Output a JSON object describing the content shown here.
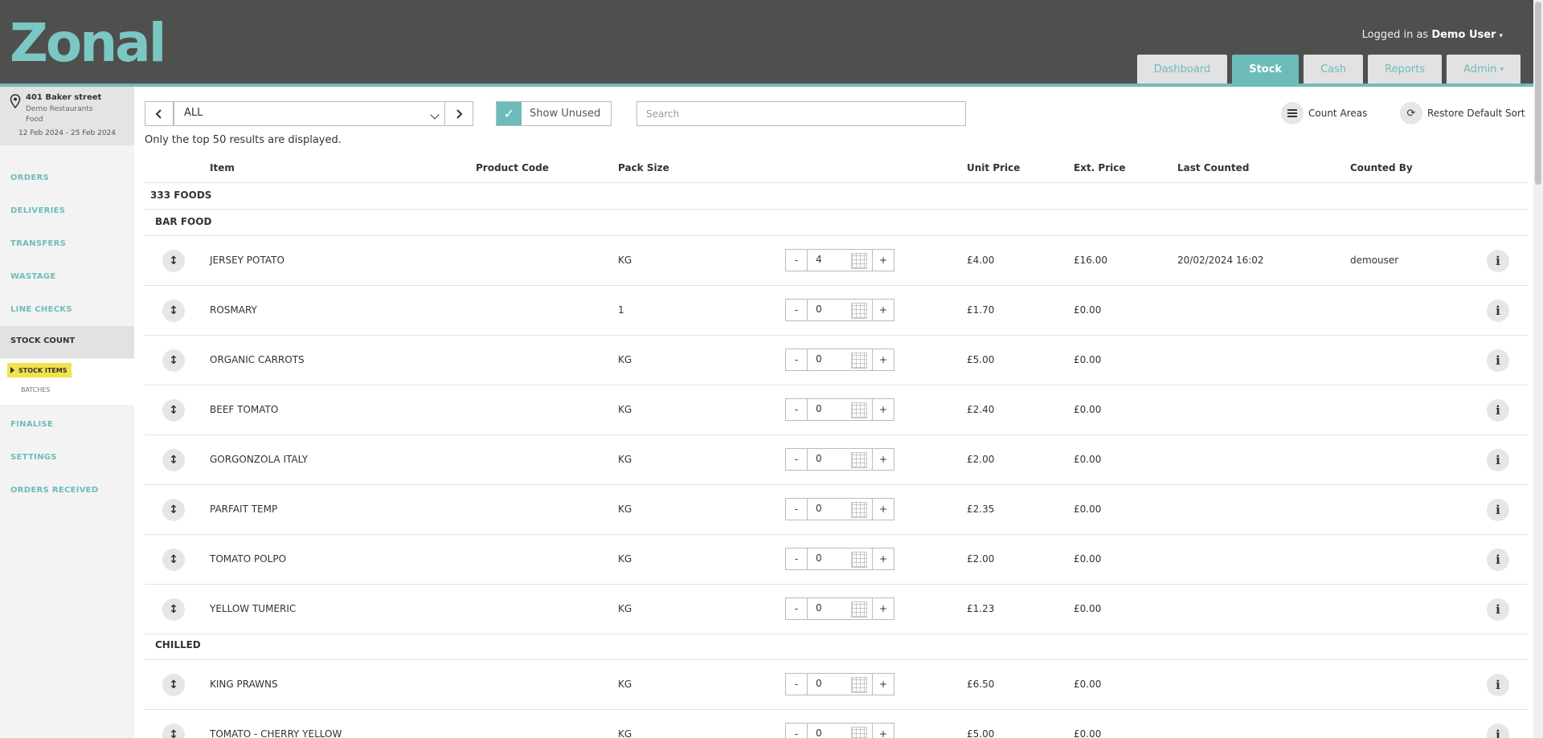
{
  "header": {
    "logo_text": "Zonal",
    "login_prefix": "Logged in as",
    "login_user": "Demo User",
    "nav": [
      {
        "label": "Dashboard",
        "active": false
      },
      {
        "label": "Stock",
        "active": true
      },
      {
        "label": "Cash",
        "active": false
      },
      {
        "label": "Reports",
        "active": false
      },
      {
        "label": "Admin",
        "active": false
      }
    ]
  },
  "location": {
    "name": "401 Baker street",
    "line1": "Demo Restaurants",
    "line2": "Food",
    "dates": "12 Feb 2024 - 25 Feb 2024"
  },
  "sidebar": {
    "items": [
      "ORDERS",
      "DELIVERIES",
      "TRANSFERS",
      "WASTAGE",
      "LINE CHECKS"
    ],
    "active": "STOCK COUNT",
    "sub_items": [
      "STOCK ITEMS",
      "BATCHES"
    ],
    "items_after": [
      "FINALISE",
      "SETTINGS",
      "ORDERS RECEIVED"
    ]
  },
  "toolbar": {
    "filter_value": "ALL",
    "show_unused": "Show Unused",
    "search_placeholder": "Search",
    "count_areas": "Count Areas",
    "restore_sort": "Restore Default Sort"
  },
  "notice": "Only the top 50 results are displayed.",
  "table": {
    "headers": {
      "item": "Item",
      "product_code": "Product Code",
      "pack_size": "Pack Size",
      "unit_price": "Unit Price",
      "ext_price": "Ext. Price",
      "last_counted": "Last Counted",
      "counted_by": "Counted By"
    },
    "category": "333 FOODS",
    "groups": [
      {
        "name": "BAR FOOD",
        "rows": [
          {
            "item": "JERSEY POTATO",
            "pack": "KG",
            "qty": "4",
            "unit": "£4.00",
            "ext": "£16.00",
            "last": "20/02/2024 16:02",
            "by": "demouser"
          },
          {
            "item": "ROSMARY",
            "pack": "1",
            "qty": "0",
            "unit": "£1.70",
            "ext": "£0.00",
            "last": "",
            "by": ""
          },
          {
            "item": "ORGANIC CARROTS",
            "pack": "KG",
            "qty": "0",
            "unit": "£5.00",
            "ext": "£0.00",
            "last": "",
            "by": ""
          },
          {
            "item": "BEEF TOMATO",
            "pack": "KG",
            "qty": "0",
            "unit": "£2.40",
            "ext": "£0.00",
            "last": "",
            "by": ""
          },
          {
            "item": "GORGONZOLA ITALY",
            "pack": "KG",
            "qty": "0",
            "unit": "£2.00",
            "ext": "£0.00",
            "last": "",
            "by": ""
          },
          {
            "item": "PARFAIT TEMP",
            "pack": "KG",
            "qty": "0",
            "unit": "£2.35",
            "ext": "£0.00",
            "last": "",
            "by": ""
          },
          {
            "item": "TOMATO POLPO",
            "pack": "KG",
            "qty": "0",
            "unit": "£2.00",
            "ext": "£0.00",
            "last": "",
            "by": ""
          },
          {
            "item": "YELLOW TUMERIC",
            "pack": "KG",
            "qty": "0",
            "unit": "£1.23",
            "ext": "£0.00",
            "last": "",
            "by": ""
          }
        ]
      },
      {
        "name": "CHILLED",
        "rows": [
          {
            "item": "KING PRAWNS",
            "pack": "KG",
            "qty": "0",
            "unit": "£6.50",
            "ext": "£0.00",
            "last": "",
            "by": ""
          },
          {
            "item": "TOMATO - CHERRY YELLOW",
            "pack": "KG",
            "qty": "0",
            "unit": "£5.00",
            "ext": "£0.00",
            "last": "",
            "by": ""
          }
        ]
      }
    ],
    "step_minus": "-",
    "step_plus": "+"
  },
  "colors": {
    "accent": "#6dbcbb",
    "header_bg": "#4f4f4d",
    "highlight": "#f1e24a"
  }
}
